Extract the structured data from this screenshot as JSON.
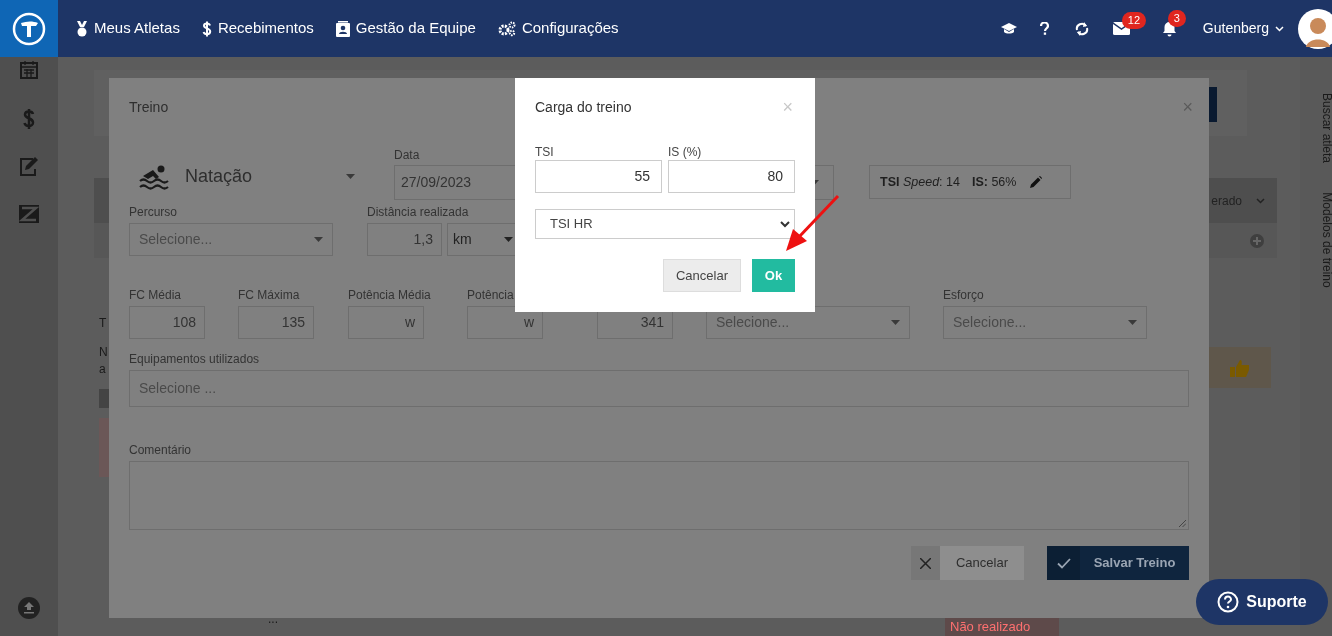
{
  "nav": {
    "items": [
      {
        "label": "Meus Atletas"
      },
      {
        "label": "Recebimentos"
      },
      {
        "label": "Gestão da Equipe"
      },
      {
        "label": "Configurações"
      }
    ],
    "mail_count": "12",
    "bell_count": "3",
    "user": "Gutenberg"
  },
  "background": {
    "fragments": [
      "T",
      "N",
      "a",
      "erado",
      "Não realizado",
      "..."
    ],
    "side_tabs": [
      "Buscar atleta",
      "Modelos de treino"
    ]
  },
  "treino_modal": {
    "title": "Treino",
    "close": "×",
    "sport": "Natação",
    "date_label": "Data",
    "date": "27/09/2023",
    "tsi_summary": "**TSI** *Speed*: 14",
    "is_summary": "**IS:** 56%",
    "percurso_label": "Percurso",
    "percurso_placeholder": "Selecione...",
    "distance_label": "Distância realizada",
    "distance": "1,3",
    "distance_unit": "km",
    "metrics": [
      {
        "label": "FC Média",
        "value": "108",
        "kind": "number"
      },
      {
        "label": "FC Máxima",
        "value": "135",
        "kind": "number"
      },
      {
        "label": "Potência Média",
        "value": "w",
        "kind": "number"
      },
      {
        "label": "Potência",
        "value": "w",
        "kind": "number"
      },
      {
        "value": "341",
        "kind": "number"
      },
      {
        "placeholder": "Selecione...",
        "kind": "select"
      },
      {
        "label": "Esforço",
        "placeholder": "Selecione...",
        "kind": "select"
      }
    ],
    "equipment_label": "Equipamentos utilizados",
    "equipment_placeholder": "Selecione ...",
    "comment_label": "Comentário",
    "cancel": "Cancelar",
    "save": "Salvar Treino"
  },
  "carga_modal": {
    "title": "Carga do treino",
    "close": "×",
    "tsi_label": "TSI",
    "tsi": "55",
    "is_label": "IS (%)",
    "is": "80",
    "method": "TSI HR",
    "cancel": "Cancelar",
    "ok": "Ok"
  },
  "support": "Suporte"
}
